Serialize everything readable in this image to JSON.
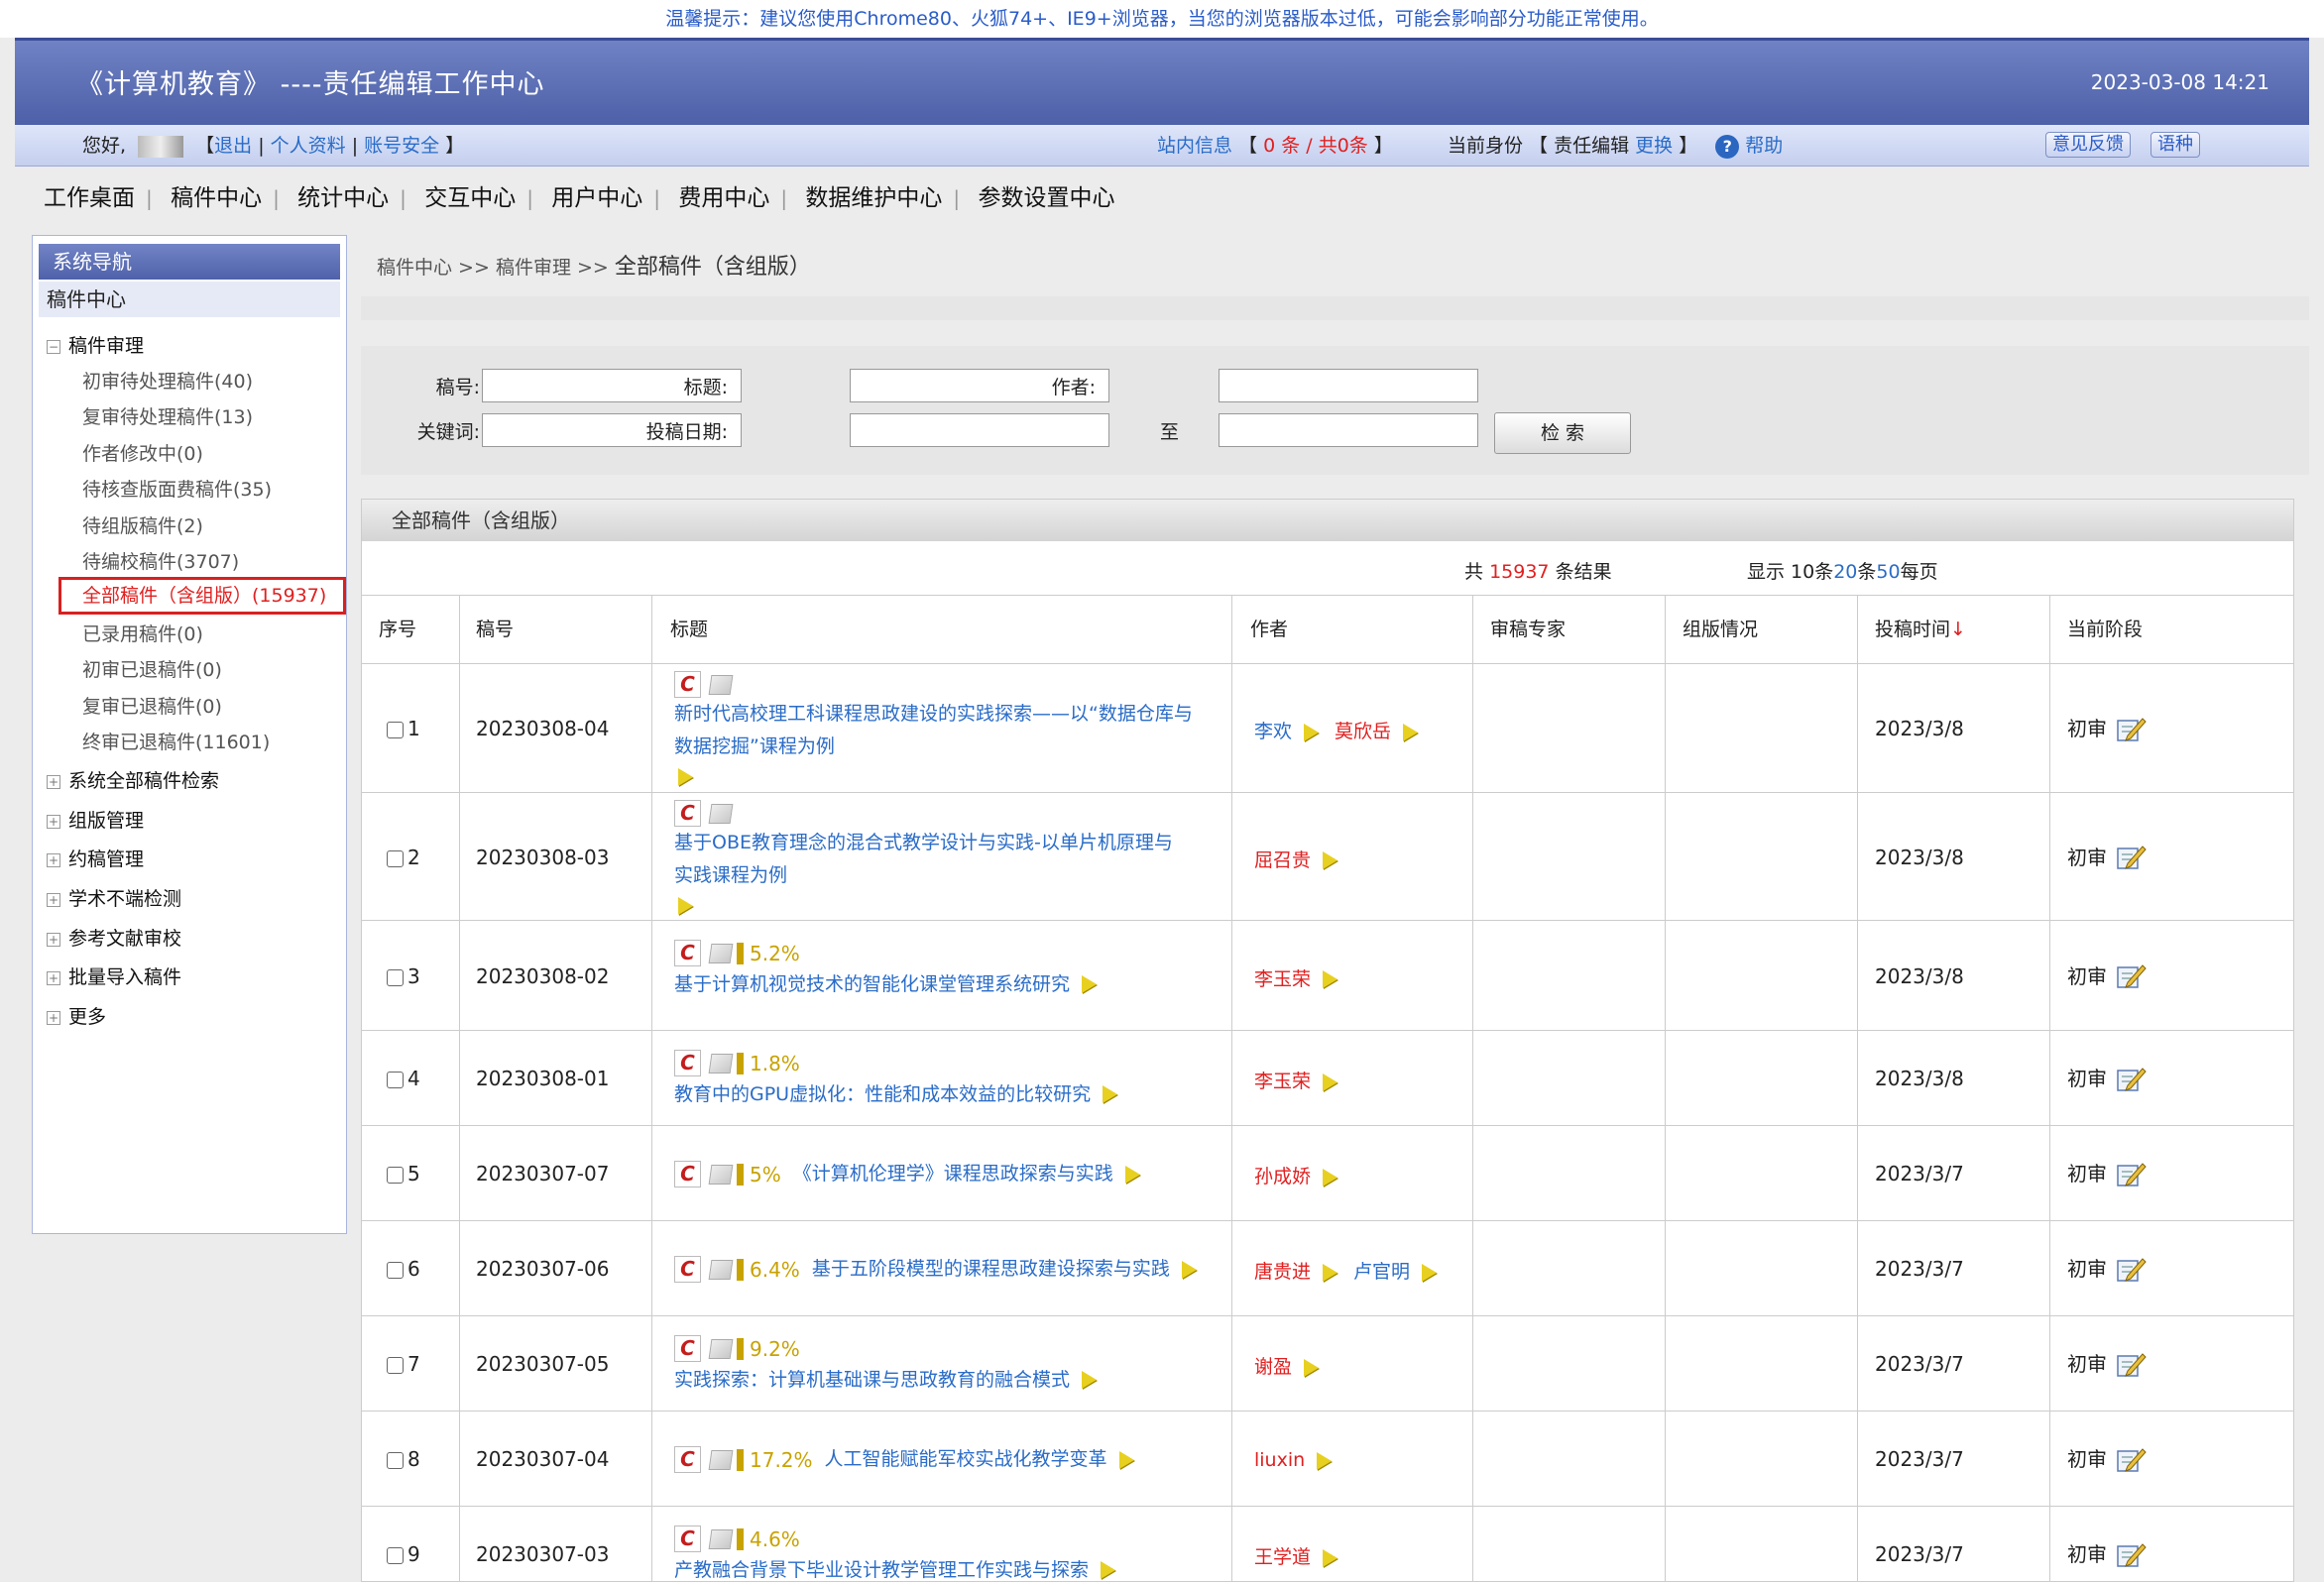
{
  "notice": "温馨提示：建议您使用Chrome80、火狐74+、IE9+浏览器，当您的浏览器版本过低，可能会影响部分功能正常使用。",
  "header": {
    "title": "《计算机教育》 ----责任编辑工作中心",
    "datetime": "2023-03-08 14:21"
  },
  "userbar": {
    "greeting": "您好,",
    "logout": "退出",
    "profile": "个人资料",
    "security": "账号安全",
    "msg_label": "站内信息",
    "msg_count": "0 条 / 共0条",
    "role_label": "当前身份",
    "role": "责任编辑",
    "change": "更换",
    "help": "帮助",
    "feedback": "意见反馈",
    "lang": "语种"
  },
  "main_nav": [
    "工作桌面",
    "稿件中心",
    "统计中心",
    "交互中心",
    "用户中心",
    "费用中心",
    "数据维护中心",
    "参数设置中心"
  ],
  "sidebar": {
    "header": "系统导航",
    "section": "稿件中心",
    "group_review": "稿件审理",
    "review_items": [
      "初审待处理稿件(40)",
      "复审待处理稿件(13)",
      "作者修改中(0)",
      "待核查版面费稿件(35)",
      "待组版稿件(2)",
      "待编校稿件(3707)",
      "全部稿件（含组版）(15937)",
      "已录用稿件(0)",
      "初审已退稿件(0)",
      "复审已退稿件(0)",
      "终审已退稿件(11601)"
    ],
    "groups": [
      "系统全部稿件检索",
      "组版管理",
      "约稿管理",
      "学术不端检测",
      "参考文献审校",
      "批量导入稿件",
      "更多"
    ]
  },
  "breadcrumb": {
    "part1": "稿件中心 >>",
    "part2": "稿件审理 >>",
    "current": "全部稿件（含组版）"
  },
  "search": {
    "id_label": "稿号:",
    "title_label": "标题:",
    "author_label": "作者:",
    "keyword_label": "关键词:",
    "date_label": "投稿日期:",
    "to_label": "至",
    "button": "检 索"
  },
  "panel": {
    "title": "全部稿件（含组版）",
    "count_prefix": "共",
    "count": "15937",
    "count_suffix": "条结果",
    "page_prefix": "显示 10条",
    "page_20": "20",
    "page_mid": "条",
    "page_50": "50",
    "page_suffix": "每页"
  },
  "columns": [
    "序号",
    "稿号",
    "标题",
    "作者",
    "审稿专家",
    "组版情况",
    "投稿时间",
    "当前阶段"
  ],
  "sort_arrow": "↓",
  "rows": [
    {
      "n": "1",
      "id": "20230308-04",
      "pct": "",
      "title1": "新时代高校理工科课程思政建设的实践探索——以“数据仓库与",
      "title2": "数据挖掘”课程为例",
      "authors": [
        {
          "name": "李欢",
          "color": "blue"
        },
        {
          "name": "莫欣岳",
          "color": "red"
        }
      ],
      "date": "2023/3/8",
      "stage": "初审"
    },
    {
      "n": "2",
      "id": "20230308-03",
      "pct": "",
      "title1": "基于OBE教育理念的混合式教学设计与实践-以单片机原理与",
      "title2": "实践课程为例",
      "authors": [
        {
          "name": "屈召贵",
          "color": "red"
        }
      ],
      "date": "2023/3/8",
      "stage": "初审"
    },
    {
      "n": "3",
      "id": "20230308-02",
      "pct": "5.2%",
      "title1": "基于计算机视觉技术的智能化课堂管理系统研究",
      "title2": "",
      "authors": [
        {
          "name": "李玉荣",
          "color": "red"
        }
      ],
      "date": "2023/3/8",
      "stage": "初审"
    },
    {
      "n": "4",
      "id": "20230308-01",
      "pct": "1.8%",
      "title1": "教育中的GPU虚拟化：性能和成本效益的比较研究",
      "title2": "",
      "authors": [
        {
          "name": "李玉荣",
          "color": "red"
        }
      ],
      "date": "2023/3/8",
      "stage": "初审"
    },
    {
      "n": "5",
      "id": "20230307-07",
      "pct": "5%",
      "title1": "《计算机伦理学》课程思政探索与实践",
      "title2": "",
      "authors": [
        {
          "name": "孙成娇",
          "color": "red"
        }
      ],
      "date": "2023/3/7",
      "stage": "初审"
    },
    {
      "n": "6",
      "id": "20230307-06",
      "pct": "6.4%",
      "title1": "基于五阶段模型的课程思政建设探索与实践",
      "title2": "",
      "authors": [
        {
          "name": "唐贵进",
          "color": "red"
        },
        {
          "name": "卢官明",
          "color": "blue"
        }
      ],
      "date": "2023/3/7",
      "stage": "初审"
    },
    {
      "n": "7",
      "id": "20230307-05",
      "pct": "9.2%",
      "title1": "实践探索：计算机基础课与思政教育的融合模式",
      "title2": "",
      "authors": [
        {
          "name": "谢盈",
          "color": "red"
        }
      ],
      "date": "2023/3/7",
      "stage": "初审"
    },
    {
      "n": "8",
      "id": "20230307-04",
      "pct": "17.2%",
      "title1": "人工智能赋能军校实战化教学变革",
      "title2": "",
      "authors": [
        {
          "name": "liuxin",
          "color": "red"
        }
      ],
      "date": "2023/3/7",
      "stage": "初审"
    },
    {
      "n": "9",
      "id": "20230307-03",
      "pct": "4.6%",
      "title1": "产教融合背景下毕业设计教学管理工作实践与探索",
      "title2": "",
      "authors": [
        {
          "name": "王学道",
          "color": "red"
        }
      ],
      "date": "2023/3/7",
      "stage": "初审"
    }
  ]
}
